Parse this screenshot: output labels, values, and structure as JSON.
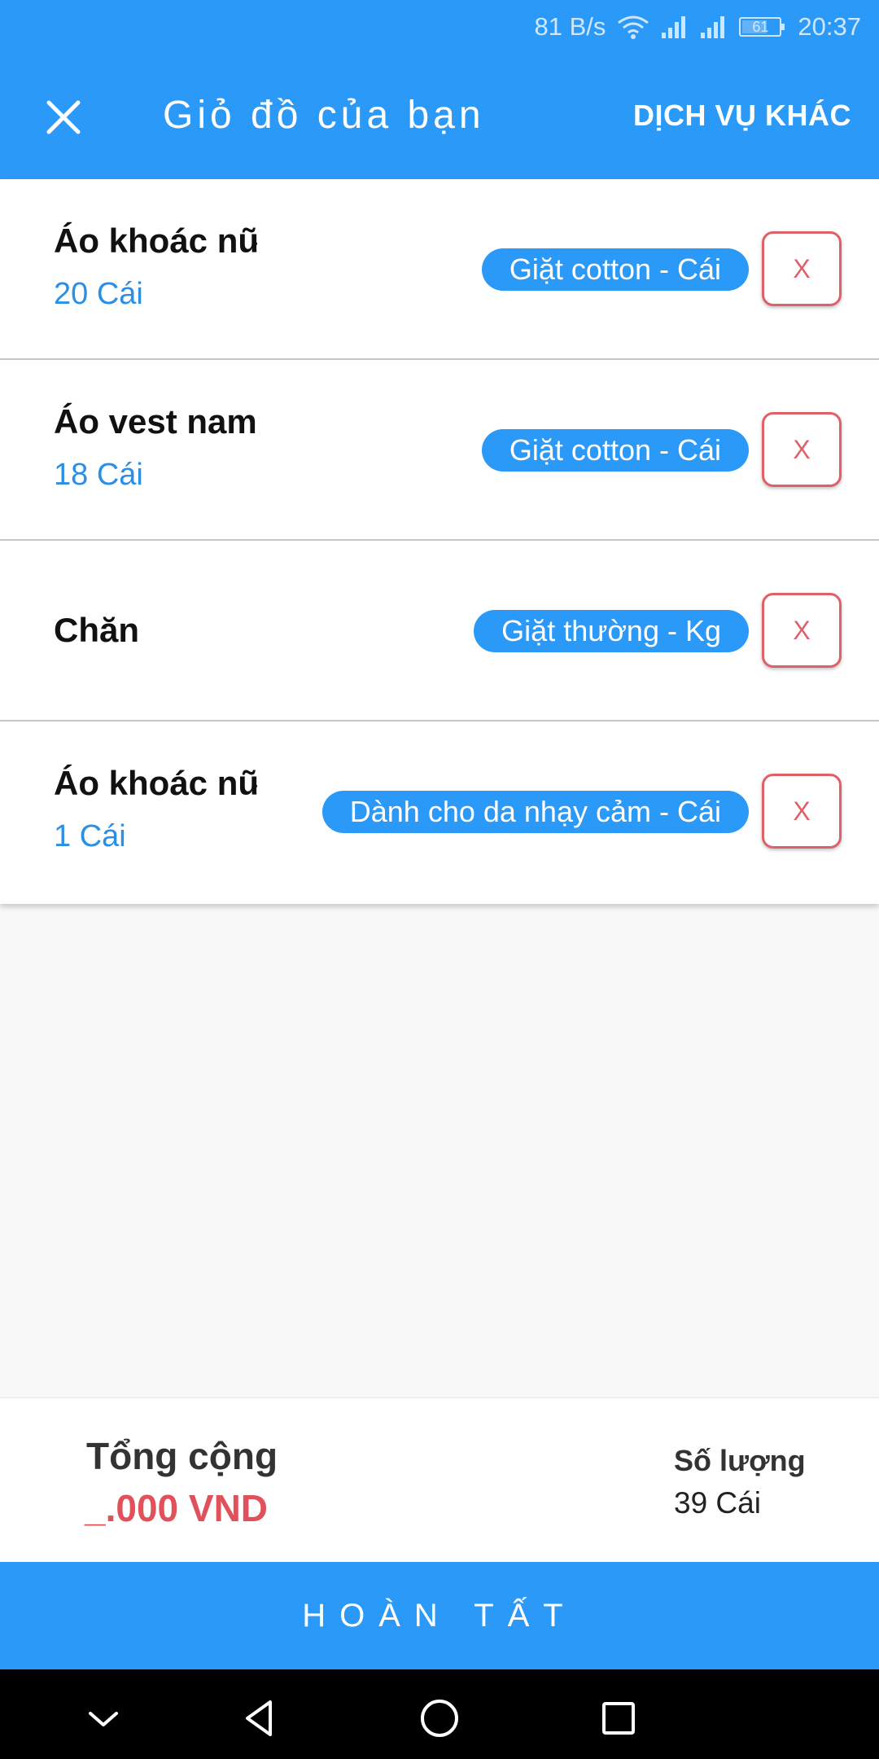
{
  "status_bar": {
    "network_speed": "81 B/s",
    "battery_level": "61",
    "time": "20:37"
  },
  "header": {
    "title": "Giỏ đồ của bạn",
    "other_services_label": "DỊCH VỤ KHÁC",
    "close_icon": "close-icon"
  },
  "cart": {
    "items": [
      {
        "name": "Áo khoác nữ",
        "quantity": "20 Cái",
        "service": "Giặt cotton - Cái",
        "remove_label": "X"
      },
      {
        "name": "Áo vest nam",
        "quantity": "18 Cái",
        "service": "Giặt cotton - Cái",
        "remove_label": "X"
      },
      {
        "name": "Chăn",
        "quantity": "",
        "service": "Giặt thường - Kg",
        "remove_label": "X"
      },
      {
        "name": "Áo khoác nữ",
        "quantity": "1 Cái",
        "service": "Dành cho da nhạy cảm - Cái",
        "remove_label": "X"
      }
    ]
  },
  "summary": {
    "total_label": "Tổng cộng",
    "total_value": "_.000 VND",
    "quantity_label": "Số lượng",
    "quantity_value": "39 Cái"
  },
  "footer": {
    "complete_label": "HOÀN TẤT"
  },
  "colors": {
    "primary": "#2b99f7",
    "danger": "#e0515c",
    "quantity_text": "#2b8fe6"
  },
  "nav_icons": [
    "chevron-down-icon",
    "back-icon",
    "home-icon",
    "recents-icon"
  ]
}
